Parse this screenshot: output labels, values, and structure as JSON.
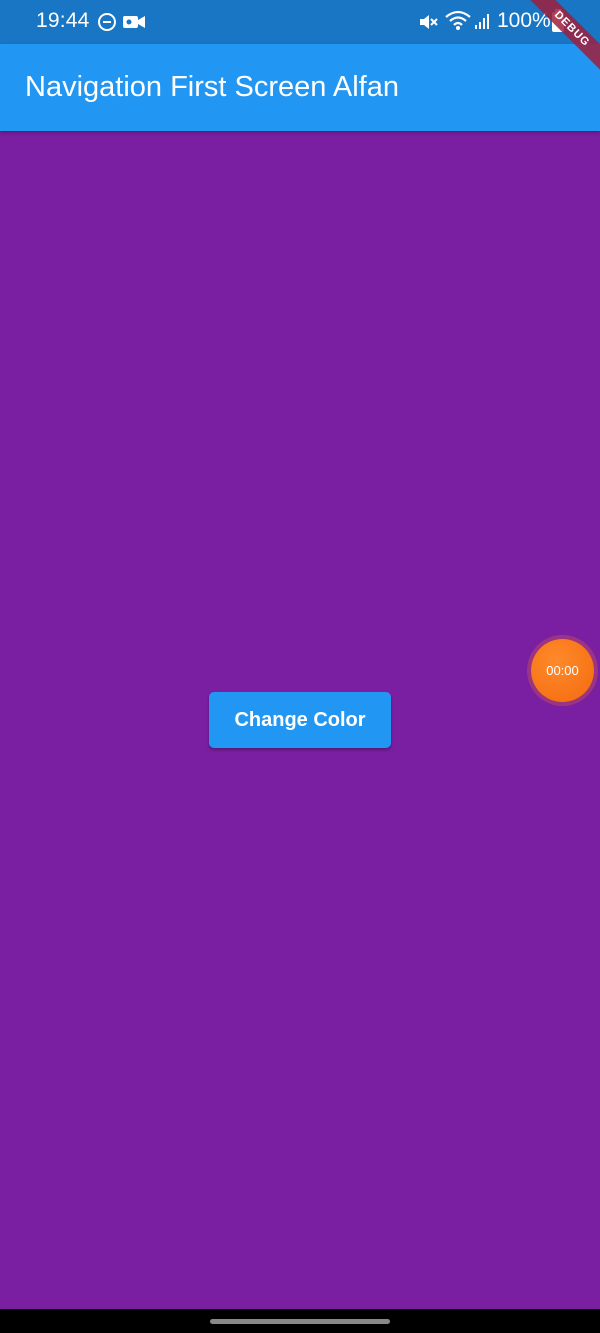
{
  "status_bar": {
    "time": "19:44",
    "battery": "100%",
    "icons": [
      "do-not-disturb-icon",
      "video-record-icon",
      "mute-icon",
      "wifi-icon",
      "signal-icon",
      "battery-icon"
    ]
  },
  "debug_banner": {
    "label": "DEBUG"
  },
  "app_bar": {
    "title": "Navigation First Screen Alfan"
  },
  "main": {
    "background_color": "#7b1fa2",
    "button_label": "Change Color"
  },
  "recorder": {
    "timer": "00:00"
  },
  "colors": {
    "status_bar": "#1976c4",
    "app_bar": "#2196f3",
    "button": "#2196f3",
    "recorder": "#f5700f"
  }
}
